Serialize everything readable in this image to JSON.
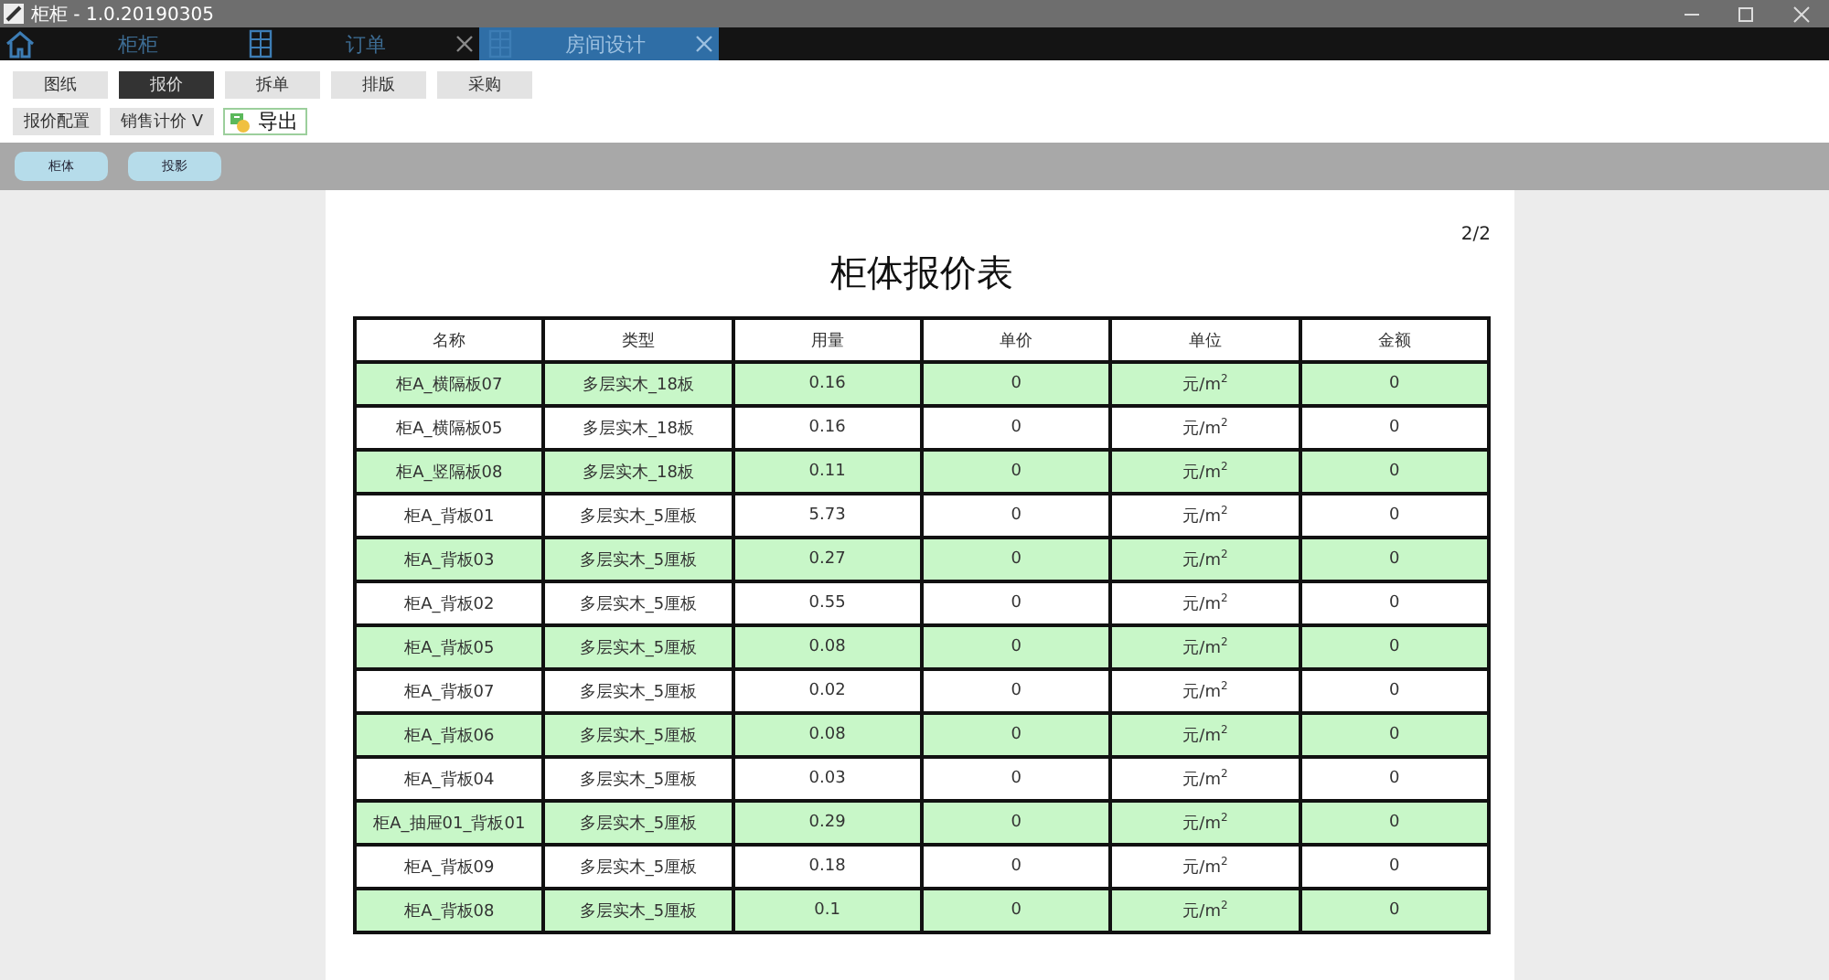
{
  "window": {
    "title": "柜柜 - 1.0.20190305"
  },
  "app_tabs": [
    {
      "label": "柜柜",
      "kind": "home",
      "closable": false,
      "selected": false
    },
    {
      "label": "订单",
      "kind": "document",
      "closable": true,
      "selected": false
    },
    {
      "label": "房间设计",
      "kind": "document",
      "closable": true,
      "selected": true
    }
  ],
  "mode_buttons": [
    {
      "label": "图纸",
      "selected": false
    },
    {
      "label": "报价",
      "selected": true
    },
    {
      "label": "拆单",
      "selected": false
    },
    {
      "label": "排版",
      "selected": false
    },
    {
      "label": "采购",
      "selected": false
    }
  ],
  "sub_buttons": [
    {
      "label": "报价配置",
      "kind": "plain"
    },
    {
      "label": "销售计价 V",
      "kind": "plain"
    },
    {
      "label": "导出",
      "kind": "export"
    }
  ],
  "view_buttons": [
    "柜体",
    "投影"
  ],
  "report": {
    "page": "2/2",
    "title": "柜体报价表",
    "columns": [
      "名称",
      "类型",
      "用量",
      "单价",
      "单位",
      "金额"
    ],
    "rows": [
      {
        "cells": [
          "柜A_横隔板07",
          "多层实木_18板",
          "0.16",
          "0",
          "元/m$^{2}$",
          "0"
        ],
        "highlighted": true
      },
      {
        "cells": [
          "柜A_横隔板05",
          "多层实木_18板",
          "0.16",
          "0",
          "元/m$^{2}$",
          "0"
        ],
        "highlighted": false
      },
      {
        "cells": [
          "柜A_竖隔板08",
          "多层实木_18板",
          "0.11",
          "0",
          "元/m$^{2}$",
          "0"
        ],
        "highlighted": true
      },
      {
        "cells": [
          "柜A_背板01",
          "多层实木_5厘板",
          "5.73",
          "0",
          "元/m$^{2}$",
          "0"
        ],
        "highlighted": false
      },
      {
        "cells": [
          "柜A_背板03",
          "多层实木_5厘板",
          "0.27",
          "0",
          "元/m$^{2}$",
          "0"
        ],
        "highlighted": true
      },
      {
        "cells": [
          "柜A_背板02",
          "多层实木_5厘板",
          "0.55",
          "0",
          "元/m$^{2}$",
          "0"
        ],
        "highlighted": false
      },
      {
        "cells": [
          "柜A_背板05",
          "多层实木_5厘板",
          "0.08",
          "0",
          "元/m$^{2}$",
          "0"
        ],
        "highlighted": true
      },
      {
        "cells": [
          "柜A_背板07",
          "多层实木_5厘板",
          "0.02",
          "0",
          "元/m$^{2}$",
          "0"
        ],
        "highlighted": false
      },
      {
        "cells": [
          "柜A_背板06",
          "多层实木_5厘板",
          "0.08",
          "0",
          "元/m$^{2}$",
          "0"
        ],
        "highlighted": true
      },
      {
        "cells": [
          "柜A_背板04",
          "多层实木_5厘板",
          "0.03",
          "0",
          "元/m$^{2}$",
          "0"
        ],
        "highlighted": false
      },
      {
        "cells": [
          "柜A_抽屉01_背板01",
          "多层实木_5厘板",
          "0.29",
          "0",
          "元/m$^{2}$",
          "0"
        ],
        "highlighted": true
      },
      {
        "cells": [
          "柜A_背板09",
          "多层实木_5厘板",
          "0.18",
          "0",
          "元/m$^{2}$",
          "0"
        ],
        "highlighted": false
      },
      {
        "cells": [
          "柜A_背板08",
          "多层实木_5厘板",
          "0.1",
          "0",
          "元/m$^{2}$",
          "0"
        ],
        "highlighted": true
      }
    ]
  }
}
